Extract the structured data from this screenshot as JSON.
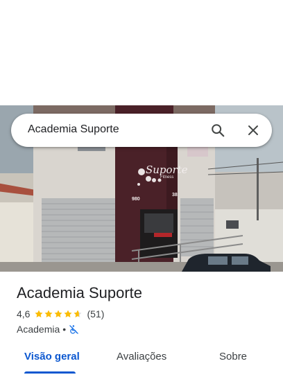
{
  "search": {
    "query": "Academia Suporte"
  },
  "place": {
    "name": "Academia Suporte",
    "rating": "4,6",
    "stars": 4.6,
    "reviews": "(51)",
    "category": "Academia",
    "separator": "•",
    "wheelchair_icon": "not-accessible-icon"
  },
  "photo": {
    "sign_text": "Suporte",
    "sign_sub": "Fitness",
    "number_left": "980",
    "number_right": "38"
  },
  "tabs": [
    {
      "label": "Visão geral",
      "active": true
    },
    {
      "label": "Avaliações",
      "active": false
    },
    {
      "label": "Sobre",
      "active": false
    }
  ],
  "colors": {
    "accent": "#0b57d0",
    "star": "#fbbc04",
    "facade": "#4a2128"
  }
}
